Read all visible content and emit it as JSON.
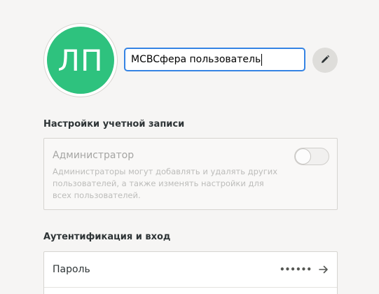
{
  "user": {
    "initials": "ЛП",
    "name_value": "MCBCфера пользователь",
    "avatar_color": "#2ec27e"
  },
  "edit_button": {
    "icon": "pencil-icon"
  },
  "account_settings": {
    "title": "Настройки учетной записи",
    "admin": {
      "label": "Администратор",
      "description": "Администраторы могут добавлять и удалять других пользователей, а также изменять настройки для всех пользователей.",
      "toggle_on": false
    }
  },
  "auth": {
    "title": "Аутентификация и вход",
    "password_label": "Пароль",
    "password_mask": "••••••",
    "arrow_icon": "arrow-right-icon"
  },
  "colors": {
    "accent": "#3584e4",
    "background": "#f6f5f4"
  }
}
